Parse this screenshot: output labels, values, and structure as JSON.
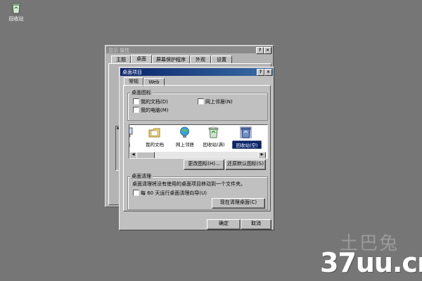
{
  "desktop": {
    "recycle_bin_label": "回收站"
  },
  "display_properties": {
    "title": "显示 属性",
    "tabs": [
      "主题",
      "桌面",
      "屏幕保护程序",
      "外观",
      "设置"
    ],
    "title_buttons": [
      "?",
      "×"
    ]
  },
  "desktop_items": {
    "title": "桌面项目",
    "title_buttons": [
      "?",
      "×"
    ],
    "tabs": [
      "常规",
      "Web"
    ],
    "icons_group": {
      "title": "桌面图标",
      "checkboxes": [
        "我的文档(D)",
        "网上邻居(N)",
        "我的电脑(M)"
      ]
    },
    "icon_list": [
      {
        "label": "脑",
        "icon": "my-computer-icon"
      },
      {
        "label": "我的文档",
        "icon": "my-documents-icon"
      },
      {
        "label": "网上邻居",
        "icon": "network-places-icon"
      },
      {
        "label": "回收站(满)",
        "icon": "recycle-bin-full-icon"
      },
      {
        "label": "回收站(空)",
        "icon": "recycle-bin-empty-icon",
        "selected": true
      }
    ],
    "change_icon_button": "更改图标(H)...",
    "restore_default_button": "还原默认图标(S)",
    "cleanup_group": {
      "title": "桌面清理",
      "description": "桌面清理将没有使用的桌面项目移动到一个文件夹。",
      "checkbox_label": "每 60 天运行桌面清理向导(U)",
      "cleanup_button": "现在清理桌面(C)"
    },
    "ok_button": "确定",
    "cancel_button": "取消"
  },
  "watermark": {
    "top": "土巴兔",
    "bottom": "37uu.cn"
  },
  "colors": {
    "desktop_bg": "#767676",
    "active_title": "#0a246a",
    "dialog_face": "#c0c0c0"
  }
}
